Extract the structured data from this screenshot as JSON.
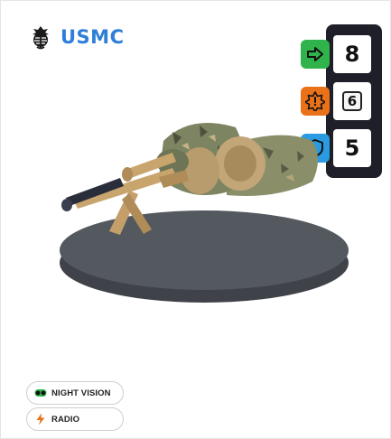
{
  "faction": {
    "name": "USMC",
    "icon": "eagle-globe-anchor-icon"
  },
  "stats": {
    "movement": {
      "icon": "arrow-right-icon",
      "color": "#2fb34a",
      "value": "8"
    },
    "attack": {
      "icon": "burst-icon",
      "color": "#e8711a",
      "value": "6"
    },
    "defense": {
      "icon": "shield-icon",
      "color": "#2a9be0",
      "value": "5"
    }
  },
  "miniature": {
    "icon": "prone-sniper-miniature"
  },
  "abilities": [
    {
      "label": "NIGHT VISION",
      "icon": "night-vision-goggles-icon",
      "color": "#2fb34a"
    },
    {
      "label": "RADIO",
      "icon": "lightning-icon",
      "color": "#e8711a"
    }
  ]
}
